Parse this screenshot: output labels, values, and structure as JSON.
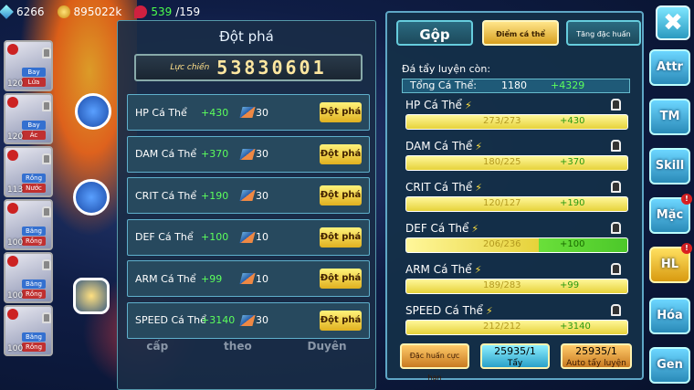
{
  "resources": {
    "gems": "6266",
    "gold": "895022k",
    "stamina": "539",
    "stamina_max": "/159"
  },
  "roster": [
    {
      "level": "120",
      "tag1": "Bay",
      "tag2": "Lửa"
    },
    {
      "level": "120",
      "tag1": "Bay",
      "tag2": "Ác"
    },
    {
      "level": "113",
      "tag1": "Rồng",
      "tag2": "Nước"
    },
    {
      "level": "100",
      "tag1": "Băng",
      "tag2": "Rồng"
    },
    {
      "level": "100",
      "tag1": "Băng",
      "tag2": "Rồng"
    },
    {
      "level": "100",
      "tag1": "Băng",
      "tag2": "Rồng"
    }
  ],
  "left_panel": {
    "title": "Đột phá",
    "power_label": "Lực chiến",
    "power_value": "53830601",
    "rows": [
      {
        "name": "HP Cá Thể",
        "bonus": "+430",
        "cost": "30",
        "button": "Đột phá"
      },
      {
        "name": "DAM Cá Thể",
        "bonus": "+370",
        "cost": "30",
        "button": "Đột phá"
      },
      {
        "name": "CRIT Cá Thể",
        "bonus": "+190",
        "cost": "30",
        "button": "Đột phá"
      },
      {
        "name": "DEF Cá Thể",
        "bonus": "+100",
        "cost": "10",
        "button": "Đột phá"
      },
      {
        "name": "ARM Cá Thể",
        "bonus": "+99",
        "cost": "10",
        "button": "Đột phá"
      },
      {
        "name": "SPEED Cá Thể",
        "bonus": "+3140",
        "cost": "30",
        "button": "Đột phá"
      }
    ],
    "bottom_tabs": [
      "cấp",
      "theo",
      "Duyên"
    ]
  },
  "right_panel": {
    "tabs": [
      "Gộp",
      "Điểm cá thể",
      "Tăng đặc huấn"
    ],
    "subtitle": "Đá tẩy luyện còn:",
    "total_label": "Tổng Cá Thể:",
    "total_value": "1180",
    "total_bonus": "+4329",
    "stats": [
      {
        "name": "HP Cá Thể",
        "current": "273/273",
        "bonus": "+430"
      },
      {
        "name": "DAM Cá Thể",
        "current": "180/225",
        "bonus": "+370"
      },
      {
        "name": "CRIT Cá Thể",
        "current": "120/127",
        "bonus": "+190"
      },
      {
        "name": "DEF Cá Thể",
        "current": "206/236",
        "bonus": "+100"
      },
      {
        "name": "ARM Cá Thể",
        "current": "189/283",
        "bonus": "+99"
      },
      {
        "name": "SPEED Cá Thể",
        "current": "212/212",
        "bonus": "+3140"
      }
    ],
    "actions": {
      "special": "Đặc huấn cực hạn",
      "wash_count": "25935/1",
      "wash_label": "Tẩy",
      "auto_count": "25935/1",
      "auto_label": "Auto tẩy luyện"
    }
  },
  "side_menu": [
    "Attr",
    "TM",
    "Skill",
    "Mặc",
    "HL",
    "Hóa",
    "Gen"
  ],
  "close_label": "✖",
  "colors": {
    "accent_yellow": "#e6d23a",
    "bonus_green": "#5cff5c",
    "panel": "#27495e"
  }
}
